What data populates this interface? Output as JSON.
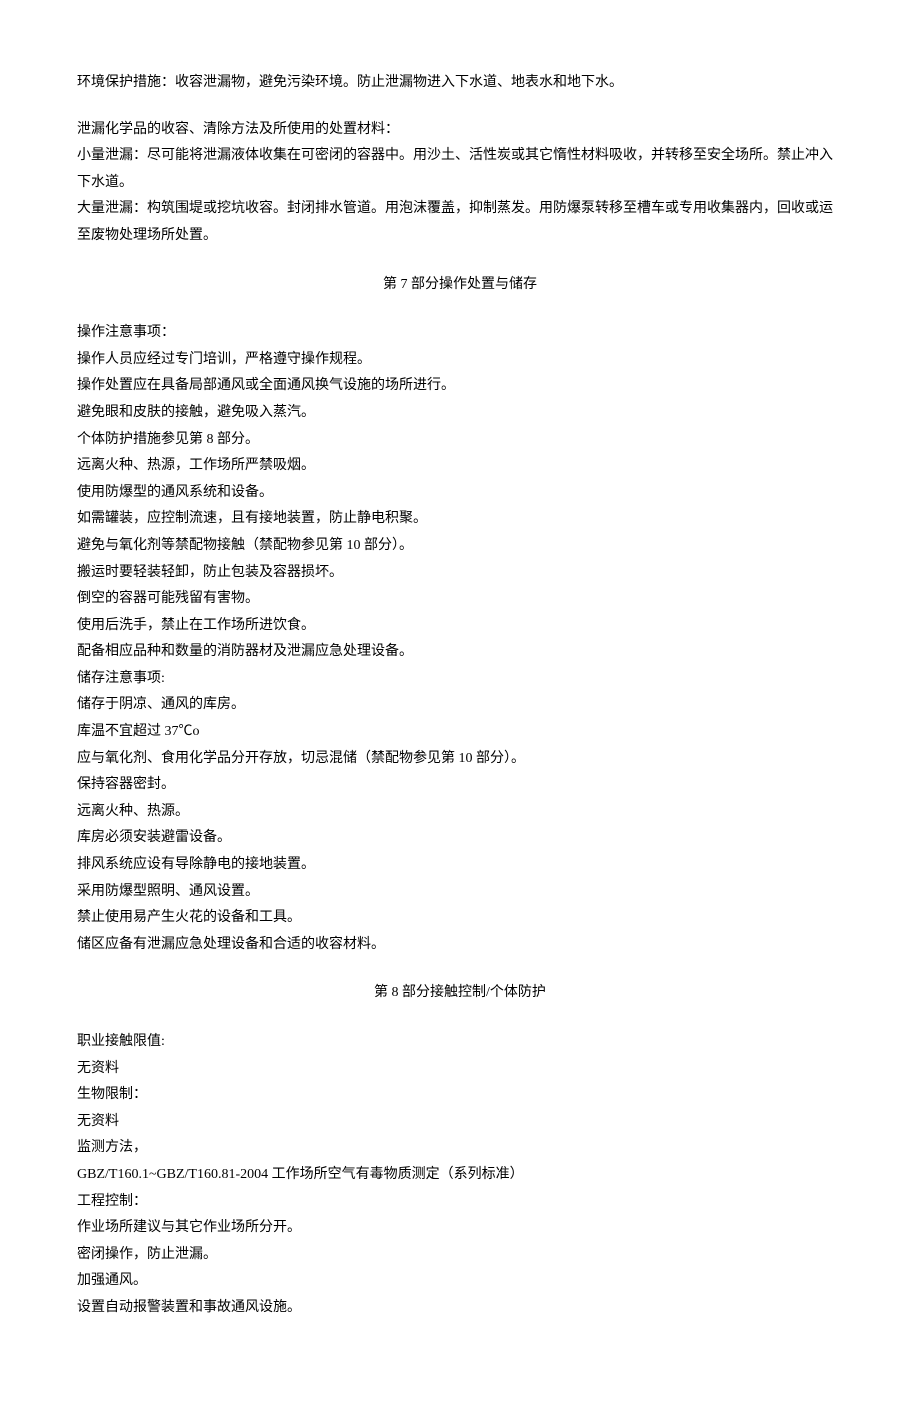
{
  "section6": {
    "env_protection": "环境保护措施：收容泄漏物，避免污染环境。防止泄漏物进入下水道、地表水和地下水。",
    "spill_header": "泄漏化学品的收容、清除方法及所使用的处置材料：",
    "small_spill": "小量泄漏：尽可能将泄漏液体收集在可密闭的容器中。用沙土、活性炭或其它惰性材料吸收，并转移至安全场所。禁止冲入下水道。",
    "large_spill": "大量泄漏：构筑围堤或挖坑收容。封闭排水管道。用泡沫覆盖，抑制蒸发。用防爆泵转移至槽车或专用收集器内，回收或运至废物处理场所处置。"
  },
  "section7": {
    "title": "第 7 部分操作处置与储存",
    "handling_header": "操作注意事项：",
    "handling": [
      "操作人员应经过专门培训，严格遵守操作规程。",
      "操作处置应在具备局部通风或全面通风换气设施的场所进行。",
      "避免眼和皮肤的接触，避免吸入蒸汽。",
      "个体防护措施参见第 8 部分。",
      "远离火种、热源，工作场所严禁吸烟。",
      "使用防爆型的通风系统和设备。",
      "如需罐装，应控制流速，且有接地装置，防止静电积聚。",
      "避免与氧化剂等禁配物接触（禁配物参见第 10 部分）。",
      "搬运时要轻装轻卸，防止包装及容器损坏。",
      "倒空的容器可能残留有害物。",
      "使用后洗手，禁止在工作场所进饮食。",
      "配备相应品种和数量的消防器材及泄漏应急处理设备。"
    ],
    "storage_header": "储存注意事项:",
    "storage": [
      "储存于阴凉、通风的库房。",
      "库温不宜超过 37℃o",
      "应与氧化剂、食用化学品分开存放，切忌混储（禁配物参见第 10 部分）。",
      "保持容器密封。",
      "远离火种、热源。",
      "库房必须安装避雷设备。",
      "排风系统应设有导除静电的接地装置。",
      "采用防爆型照明、通风设置。",
      "禁止使用易产生火花的设备和工具。",
      "储区应备有泄漏应急处理设备和合适的收容材料。"
    ]
  },
  "section8": {
    "title": "第 8 部分接触控制/个体防护",
    "occ_limit_header": "职业接触限值:",
    "occ_limit": "无资料",
    "bio_limit_header": "生物限制：",
    "bio_limit": "无资料",
    "monitor_header": "监测方法，",
    "monitor": "GBZ/T160.1~GBZ/T160.81-2004 工作场所空气有毒物质测定（系列标准）",
    "eng_control_header": "工程控制：",
    "eng_control": [
      "作业场所建议与其它作业场所分开。",
      "密闭操作，防止泄漏。",
      "加强通风。",
      "设置自动报警装置和事故通风设施。"
    ]
  }
}
